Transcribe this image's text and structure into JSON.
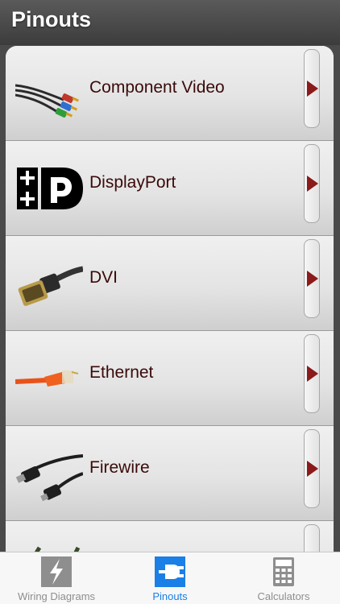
{
  "header": {
    "title": "Pinouts"
  },
  "list": {
    "items": [
      {
        "label": "Component Video",
        "icon": "component-video-cable-icon"
      },
      {
        "label": "DisplayPort",
        "icon": "displayport-logo-icon"
      },
      {
        "label": "DVI",
        "icon": "dvi-cable-icon"
      },
      {
        "label": "Ethernet",
        "icon": "ethernet-cable-icon"
      },
      {
        "label": "Firewire",
        "icon": "firewire-cable-icon"
      },
      {
        "label": "",
        "icon": "cable-icon"
      }
    ],
    "accessory_icon": "disclosure-arrow-icon"
  },
  "tabbar": {
    "tabs": [
      {
        "label": "Wiring Diagrams",
        "icon": "lightning-bolt-icon",
        "active": false
      },
      {
        "label": "Pinouts",
        "icon": "plug-icon",
        "active": true
      },
      {
        "label": "Calculators",
        "icon": "calculator-icon",
        "active": false
      }
    ]
  },
  "colors": {
    "header_bg": "#4a4a4a",
    "row_label": "#3a0a0a",
    "accessory_arrow": "#8b1a1a",
    "active_tab": "#1a7fe6",
    "inactive_tab": "#8e8e8e"
  }
}
